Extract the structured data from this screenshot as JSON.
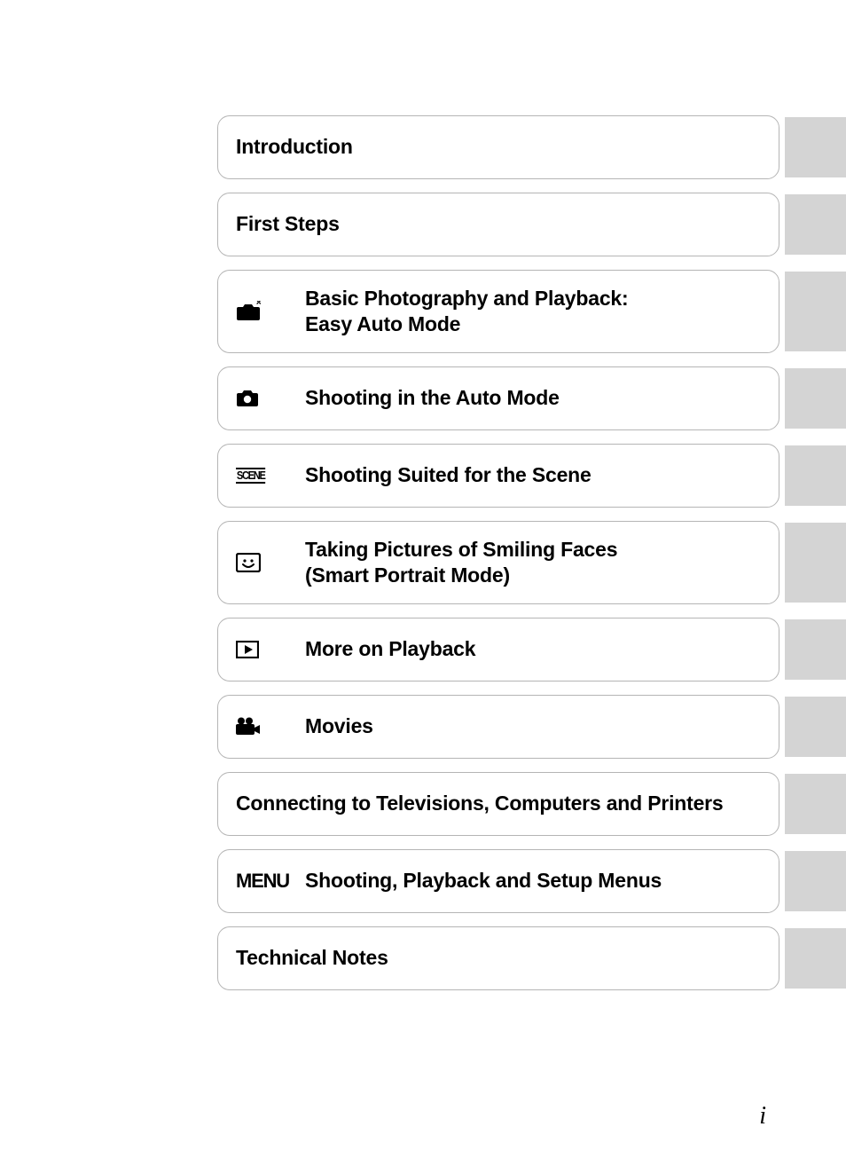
{
  "toc": {
    "items": [
      {
        "icon": null,
        "label": "Introduction",
        "tall": false
      },
      {
        "icon": null,
        "label": "First Steps",
        "tall": false
      },
      {
        "icon": "easy-auto",
        "label": "Basic Photography and Playback:\nEasy Auto Mode",
        "tall": true
      },
      {
        "icon": "camera",
        "label": "Shooting in the Auto Mode",
        "tall": false
      },
      {
        "icon": "scene",
        "label": "Shooting Suited for the Scene",
        "tall": false
      },
      {
        "icon": "smile",
        "label": "Taking Pictures of Smiling Faces\n(Smart Portrait Mode)",
        "tall": true
      },
      {
        "icon": "play",
        "label": "More on Playback",
        "tall": false
      },
      {
        "icon": "movie",
        "label": "Movies",
        "tall": false
      },
      {
        "icon": null,
        "label": "Connecting to Televisions, Computers and Printers",
        "tall": false
      },
      {
        "icon": "menu",
        "label": "Shooting, Playback and Setup Menus",
        "tall": false
      },
      {
        "icon": null,
        "label": "Technical Notes",
        "tall": false
      }
    ]
  },
  "icon_labels": {
    "scene": "SCENE",
    "menu": "MENU"
  },
  "page_number": "i"
}
